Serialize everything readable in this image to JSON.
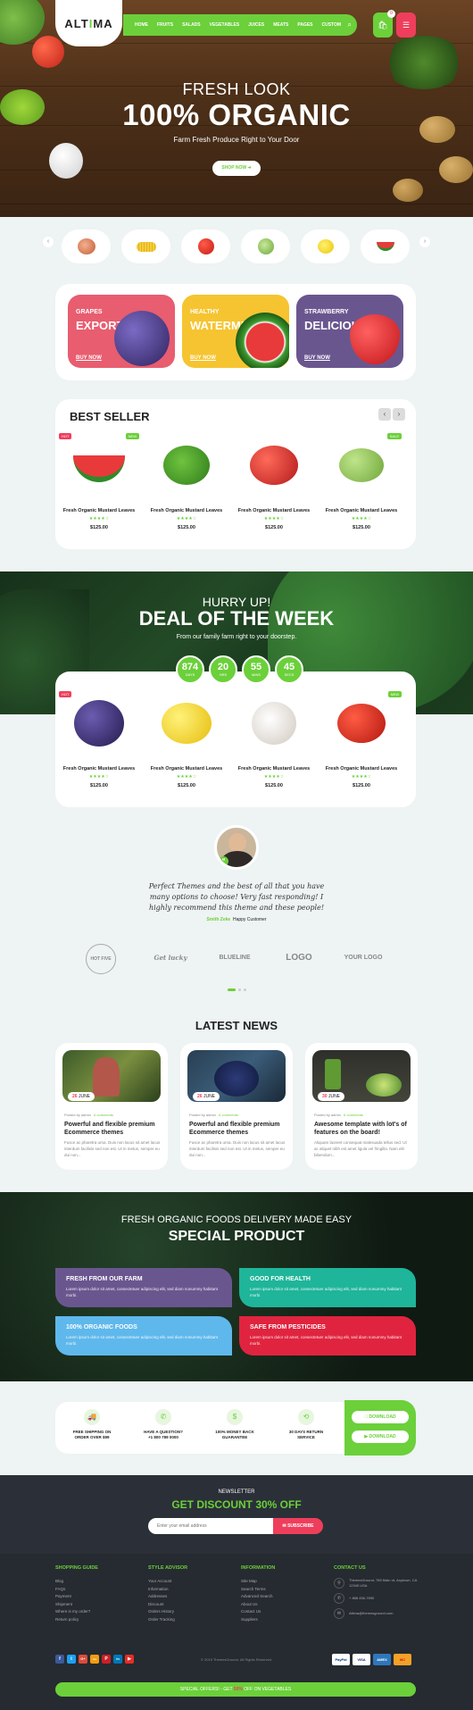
{
  "header": {
    "logo_left": "ALT",
    "logo_accent": "I",
    "logo_right": "MA",
    "nav": [
      "HOME",
      "FRUITS",
      "SALADS",
      "VEGETABLES",
      "JUICES",
      "MEATS",
      "PAGES",
      "CUSTOM"
    ],
    "cart_count": "0"
  },
  "hero": {
    "subtitle": "FRESH LOOK",
    "title": "100% ORGANIC",
    "description": "Farm Fresh Produce Right to Your Door",
    "button": "SHOP NOW ➜"
  },
  "promos": [
    {
      "line1": "GRAPES",
      "line2": "EXPORTED",
      "cta": "BUY NOW",
      "color": "#e85d6f"
    },
    {
      "line1": "HEALTHY",
      "line2": "WATERMELON",
      "cta": "BUY NOW",
      "color": "#f5c430"
    },
    {
      "line1": "STRAWBERRY",
      "line2": "DELICIOUS",
      "cta": "BUY NOW",
      "color": "#6a568f"
    }
  ],
  "best_seller": {
    "title": "BEST SELLER",
    "products": [
      {
        "name": "Fresh Organic Mustard Leaves",
        "price": "$125.00",
        "stars": "★★★★☆",
        "tag": "HOT",
        "tag2": "NEW"
      },
      {
        "name": "Fresh Organic Mustard Leaves",
        "price": "$125.00",
        "stars": "★★★★☆",
        "tag": "",
        "tag2": ""
      },
      {
        "name": "Fresh Organic Mustard Leaves",
        "price": "$125.00",
        "stars": "★★★★☆",
        "tag": "",
        "tag2": ""
      },
      {
        "name": "Fresh Organic Mustard Leaves",
        "price": "$125.00",
        "stars": "★★★★☆",
        "tag": "",
        "tag2": "SALE"
      }
    ]
  },
  "deal": {
    "subtitle": "HURRY UP!",
    "title": "DEAL OF THE WEEK",
    "description": "From our family farm right to your doorstep.",
    "countdown": [
      {
        "value": "874",
        "label": "DAYS"
      },
      {
        "value": "20",
        "label": "HRS"
      },
      {
        "value": "55",
        "label": "MINS"
      },
      {
        "value": "45",
        "label": "SECS"
      }
    ],
    "products": [
      {
        "name": "Fresh Organic Mustard Leaves",
        "price": "$125.00",
        "stars": "★★★★☆",
        "tag": "HOT"
      },
      {
        "name": "Fresh Organic Mustard Leaves",
        "price": "$125.00",
        "stars": "★★★★☆",
        "tag": ""
      },
      {
        "name": "Fresh Organic Mustard Leaves",
        "price": "$125.00",
        "stars": "★★★★☆",
        "tag": ""
      },
      {
        "name": "Fresh Organic Mustard Leaves",
        "price": "$125.00",
        "stars": "★★★★☆",
        "tag": "NEW"
      }
    ]
  },
  "testimonial": {
    "quote": "Perfect Themes and the best of all that you have many options to choose! Very fast responding! I highly recommend this theme and these people!",
    "name": "Smith Zeke",
    "role": "Happy Customer"
  },
  "brands": [
    "HOT FIVE",
    "Get lucky",
    "BLUELINE",
    "LOGO",
    "YOUR LOGO"
  ],
  "news": {
    "title": "LATEST NEWS",
    "items": [
      {
        "date_day": "26",
        "date_month": "JUNE",
        "meta": "Posted by admin",
        "comments": "6 comments",
        "title": "Powerful and flexible premium Ecommerce themes",
        "excerpt": "Fusce ac pharetra urna. Duis non lacus sit amet lacus interdum facilisis sed non est. Ut in metus, semper eu dui non..."
      },
      {
        "date_day": "26",
        "date_month": "JUNE",
        "meta": "Posted by admin",
        "comments": "6 comments",
        "title": "Powerful and flexible premium Ecommerce themes",
        "excerpt": "Fusce ac pharetra urna. Duis non lacus sit amet lacus interdum facilisis sed non est. Ut in metus, semper eu dui non..."
      },
      {
        "date_day": "30",
        "date_month": "JUNE",
        "meta": "Posted by admin",
        "comments": "6 comments",
        "title": "Awesome template with lot's of features on the board!",
        "excerpt": "Aliquam laoreet consequat malesuada tellus sed. Ut ac aliquet nibh est amet ligula vel fringilla. Nam elit bibendum..."
      }
    ]
  },
  "special": {
    "subtitle": "FRESH ORGANIC FOODS DELIVERY MADE EASY",
    "title": "SPECIAL PRODUCT",
    "cards": [
      {
        "title": "FRESH FROM OUR FARM",
        "desc": "Lorem ipsum dolor sit amet, consectetuer adipiscing elit, sed diam nonummy habitant morbi.",
        "color": "#6a568f"
      },
      {
        "title": "GOOD FOR HEALTH",
        "desc": "Lorem ipsum dolor sit amet, consectetuer adipiscing elit, sed diam nonummy habitant morbi.",
        "color": "#1fb59a"
      },
      {
        "title": "100% ORGANIC FOODS",
        "desc": "Lorem ipsum dolor sit amet, consectetuer adipiscing elit, sed diam nonummy habitant morbi.",
        "color": "#5fb8ec"
      },
      {
        "title": "SAFE FROM PESTICIDES",
        "desc": "Lorem ipsum dolor sit amet, consectetuer adipiscing elit, sed diam nonummy habitant morbi.",
        "color": "#e0243f"
      }
    ]
  },
  "features": [
    {
      "icon": "truck-icon",
      "line1": "FREE SHIPPING ON",
      "line2": "ORDER OVER $99"
    },
    {
      "icon": "phone-icon",
      "line1": "HAVE A QUESTION?",
      "line2": "+1 800 789 0000"
    },
    {
      "icon": "dollar-icon",
      "line1": "100% MONEY BACK",
      "line2": "GUARANTEE"
    },
    {
      "icon": "return-icon",
      "line1": "30 DAYS RETURN",
      "line2": "SERVICE"
    }
  ],
  "downloads": [
    "DOWNLOAD",
    "DOWNLOAD"
  ],
  "newsletter": {
    "label": "NEWSLETTER",
    "title": "GET DISCOUNT 30% OFF",
    "placeholder": "Enter your email address",
    "button": "✉ SUBSCRIBE"
  },
  "footer": {
    "columns": [
      {
        "title": "SHOPPING GUIDE",
        "links": [
          "Blog",
          "FAQs",
          "Payment",
          "Shipment",
          "Where is my order?",
          "Return policy"
        ]
      },
      {
        "title": "STYLE ADVISOR",
        "links": [
          "Your Account",
          "Information",
          "Addresses",
          "Discount",
          "Orders History",
          "Order Tracking"
        ]
      },
      {
        "title": "INFORMATION",
        "links": [
          "Site Map",
          "Search Terms",
          "Advanced Search",
          "About Us",
          "Contact Us",
          "Suppliers"
        ]
      }
    ],
    "contact": {
      "title": "CONTACT US",
      "address": "ThemesGround, 789 Main rd, Anytown, CA 12345 USA",
      "phone": "+ 888 456-7890",
      "email": "Altima@themesground.com"
    },
    "social": [
      "f",
      "t",
      "G+",
      "rss",
      "P",
      "in",
      "▶"
    ],
    "copyright": "© 2019 ThemesGround. All Rights Reserved.",
    "payments": [
      "PayPal",
      "VISA",
      "AMEX",
      "MC"
    ],
    "promo_text_left": "SPECIAL OFFERS! - GET",
    "promo_percent": "50%",
    "promo_text_right": "OFF ON VEGETABLES"
  }
}
